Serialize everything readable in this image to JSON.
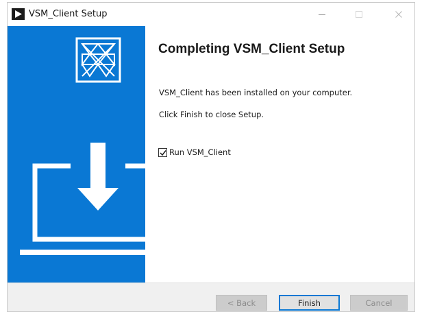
{
  "window": {
    "title": "VSM_Client Setup",
    "app_icon": "play-triangle-icon",
    "controls": {
      "minimize_icon": "minimize-icon",
      "maximize_icon": "maximize-icon",
      "close_icon": "close-icon"
    }
  },
  "side_panel": {
    "background": "#0a78d4",
    "logo_icon": "installer-logo-icon",
    "illustration_icon": "laptop-download-icon"
  },
  "content": {
    "heading": "Completing VSM_Client Setup",
    "message_installed": "VSM_Client has been installed on your computer.",
    "message_finish": "Click Finish to close Setup.",
    "run_checkbox": {
      "label": "Run VSM_Client",
      "checked": true
    }
  },
  "buttons": {
    "back_label": "< Back",
    "finish_label": "Finish",
    "cancel_label": "Cancel",
    "back_enabled": false,
    "cancel_enabled": false,
    "default_border_color": "#0a78d4"
  }
}
